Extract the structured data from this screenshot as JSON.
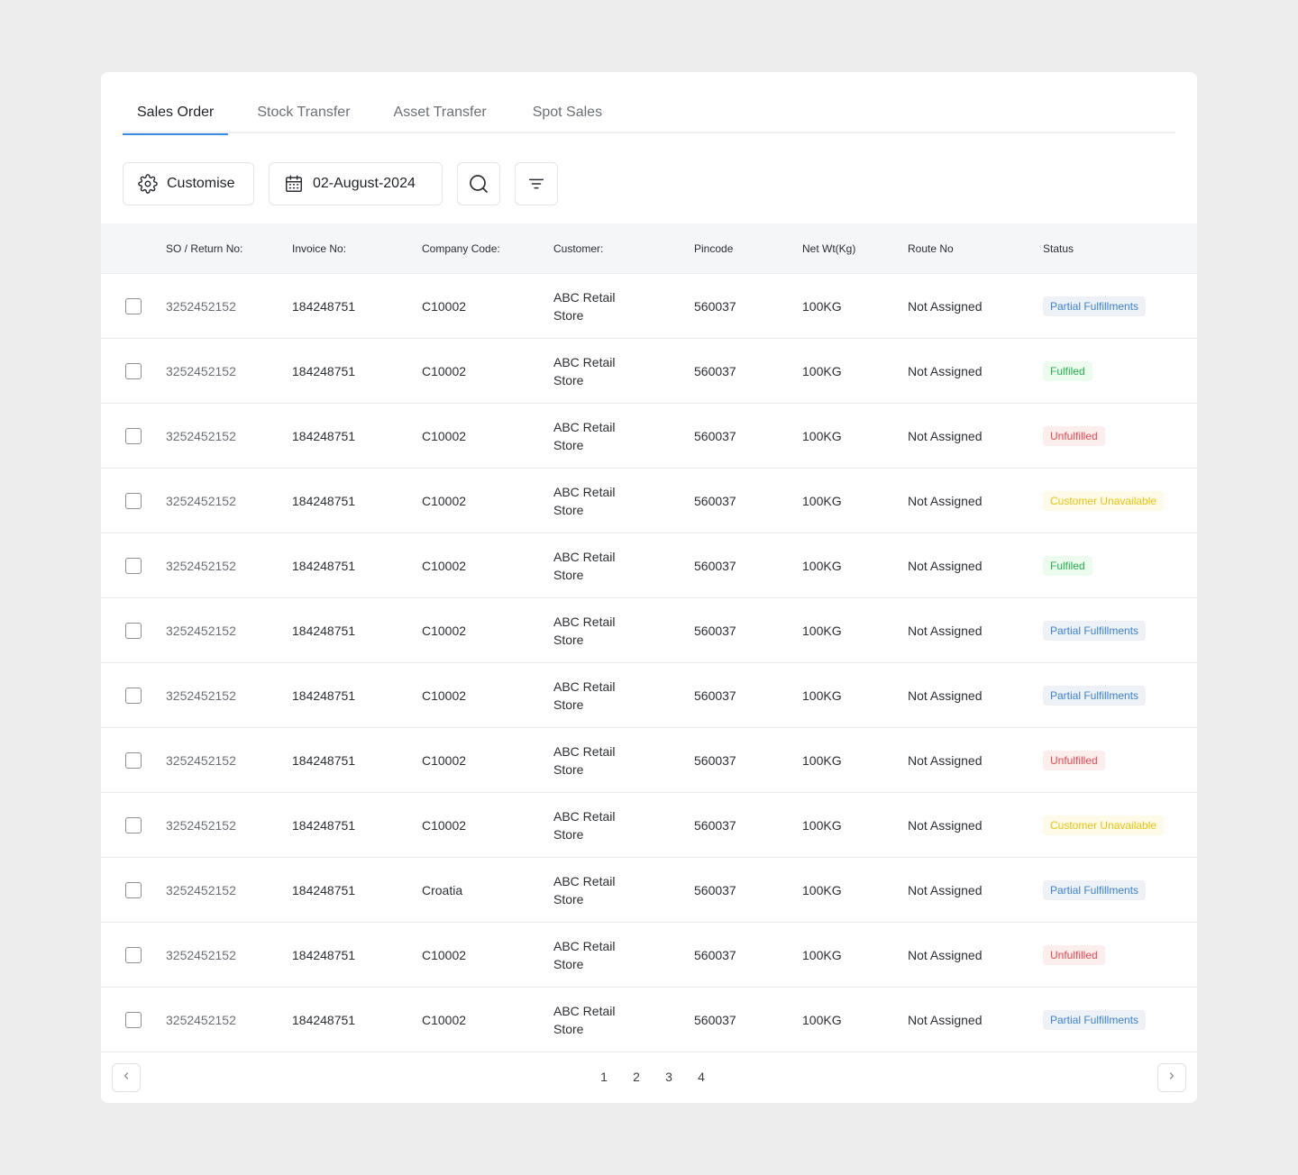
{
  "tabs": [
    {
      "label": "Sales Order",
      "active": true
    },
    {
      "label": "Stock Transfer",
      "active": false
    },
    {
      "label": "Asset Transfer",
      "active": false
    },
    {
      "label": "Spot Sales",
      "active": false
    }
  ],
  "toolbar": {
    "customise_label": "Customise",
    "customise_icon": "gear-icon",
    "date_label": "02-August-2024",
    "date_icon": "calendar-icon",
    "search_icon": "search-icon",
    "filter_icon": "filter-icon"
  },
  "table": {
    "columns": [
      "SO / Return No:",
      "Invoice No:",
      "Company Code:",
      "Customer:",
      "Pincode",
      "Net Wt(Kg)",
      "Route No",
      "Status"
    ],
    "rows": [
      {
        "so": "3252452152",
        "invoice": "184248751",
        "company": "C10002",
        "customer_line1": "ABC Retail",
        "customer_line2": "Store",
        "pincode": "560037",
        "net_wt": "100KG",
        "route": "Not Assigned",
        "status": "Partial Fulfillments",
        "status_type": "partial"
      },
      {
        "so": "3252452152",
        "invoice": "184248751",
        "company": "C10002",
        "customer_line1": "ABC Retail",
        "customer_line2": "Store",
        "pincode": "560037",
        "net_wt": "100KG",
        "route": "Not Assigned",
        "status": "Fulfiled",
        "status_type": "fulfilled"
      },
      {
        "so": "3252452152",
        "invoice": "184248751",
        "company": "C10002",
        "customer_line1": "ABC Retail",
        "customer_line2": "Store",
        "pincode": "560037",
        "net_wt": "100KG",
        "route": "Not Assigned",
        "status": "Unfulfilled",
        "status_type": "unfulfilled"
      },
      {
        "so": "3252452152",
        "invoice": "184248751",
        "company": "C10002",
        "customer_line1": "ABC Retail",
        "customer_line2": "Store",
        "pincode": "560037",
        "net_wt": "100KG",
        "route": "Not Assigned",
        "status": "Customer Unavailable",
        "status_type": "unavailable"
      },
      {
        "so": "3252452152",
        "invoice": "184248751",
        "company": "C10002",
        "customer_line1": "ABC Retail",
        "customer_line2": "Store",
        "pincode": "560037",
        "net_wt": "100KG",
        "route": "Not Assigned",
        "status": "Fulfiled",
        "status_type": "fulfilled"
      },
      {
        "so": "3252452152",
        "invoice": "184248751",
        "company": "C10002",
        "customer_line1": "ABC Retail",
        "customer_line2": "Store",
        "pincode": "560037",
        "net_wt": "100KG",
        "route": "Not Assigned",
        "status": "Partial Fulfillments",
        "status_type": "partial"
      },
      {
        "so": "3252452152",
        "invoice": "184248751",
        "company": "C10002",
        "customer_line1": "ABC Retail",
        "customer_line2": "Store",
        "pincode": "560037",
        "net_wt": "100KG",
        "route": "Not Assigned",
        "status": "Partial Fulfillments",
        "status_type": "partial"
      },
      {
        "so": "3252452152",
        "invoice": "184248751",
        "company": "C10002",
        "customer_line1": "ABC Retail",
        "customer_line2": "Store",
        "pincode": "560037",
        "net_wt": "100KG",
        "route": "Not Assigned",
        "status": "Unfulfilled",
        "status_type": "unfulfilled"
      },
      {
        "so": "3252452152",
        "invoice": "184248751",
        "company": "C10002",
        "customer_line1": "ABC Retail",
        "customer_line2": "Store",
        "pincode": "560037",
        "net_wt": "100KG",
        "route": "Not Assigned",
        "status": "Customer Unavailable",
        "status_type": "unavailable"
      },
      {
        "so": "3252452152",
        "invoice": "184248751",
        "company": "Croatia",
        "customer_line1": "ABC Retail",
        "customer_line2": "Store",
        "pincode": "560037",
        "net_wt": "100KG",
        "route": "Not Assigned",
        "status": "Partial Fulfillments",
        "status_type": "partial"
      },
      {
        "so": "3252452152",
        "invoice": "184248751",
        "company": "C10002",
        "customer_line1": "ABC Retail",
        "customer_line2": "Store",
        "pincode": "560037",
        "net_wt": "100KG",
        "route": "Not Assigned",
        "status": "Unfulfilled",
        "status_type": "unfulfilled"
      },
      {
        "so": "3252452152",
        "invoice": "184248751",
        "company": "C10002",
        "customer_line1": "ABC Retail",
        "customer_line2": "Store",
        "pincode": "560037",
        "net_wt": "100KG",
        "route": "Not Assigned",
        "status": "Partial Fulfillments",
        "status_type": "partial"
      }
    ]
  },
  "pagination": {
    "pages": [
      "1",
      "2",
      "3",
      "4"
    ],
    "prev_icon": "chevron-left-icon",
    "next_icon": "chevron-right-icon"
  },
  "colors": {
    "accent": "#3b8ae6",
    "partial": "#3b82d6",
    "fulfilled": "#22b14c",
    "unfulfilled": "#e5484d",
    "unavailable": "#e8c20e"
  }
}
